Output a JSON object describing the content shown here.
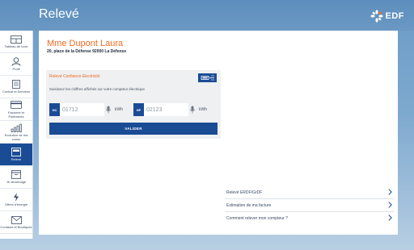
{
  "header": {
    "title": "Relevé",
    "logo_text": "EDF"
  },
  "sidebar": {
    "items": [
      {
        "label": "Tableau de bord",
        "icon": "dashboard-icon"
      },
      {
        "label": "Profil",
        "icon": "user-icon"
      },
      {
        "label": "Contrat et Services",
        "icon": "document-icon"
      },
      {
        "label": "Factures et Paiements",
        "icon": "card-icon"
      },
      {
        "label": "Evolution de ma conso",
        "icon": "bar-chart-icon"
      },
      {
        "label": "Relevé",
        "icon": "meter-icon",
        "active": true
      },
      {
        "label": "Je déménage",
        "icon": "box-icon"
      },
      {
        "label": "Offres d'énergie",
        "icon": "bolt-icon"
      },
      {
        "label": "Contacts et Boutiques",
        "icon": "mail-icon"
      }
    ]
  },
  "client": {
    "name": "Mme Dupont Laura",
    "address": "20, place de la Défense 92000 La Défense"
  },
  "meter_panel": {
    "title": "Relevé Confiance Electricité",
    "instructions": "Saisissez les chiffres affichés sur votre compteur électrique",
    "readings": [
      {
        "tag": "HC",
        "value": "01712",
        "unit": "kWh"
      },
      {
        "tag": "HP",
        "value": "02123",
        "unit": "kWh"
      }
    ],
    "validate_label": "VALIDER"
  },
  "links": [
    {
      "label": "Relevé ERDF/GrDF"
    },
    {
      "label": "Estimation de ma facture"
    },
    {
      "label": "Comment relever mon compteur ?"
    }
  ],
  "colors": {
    "brand_blue": "#1a4c96",
    "accent_orange": "#f26b21"
  }
}
